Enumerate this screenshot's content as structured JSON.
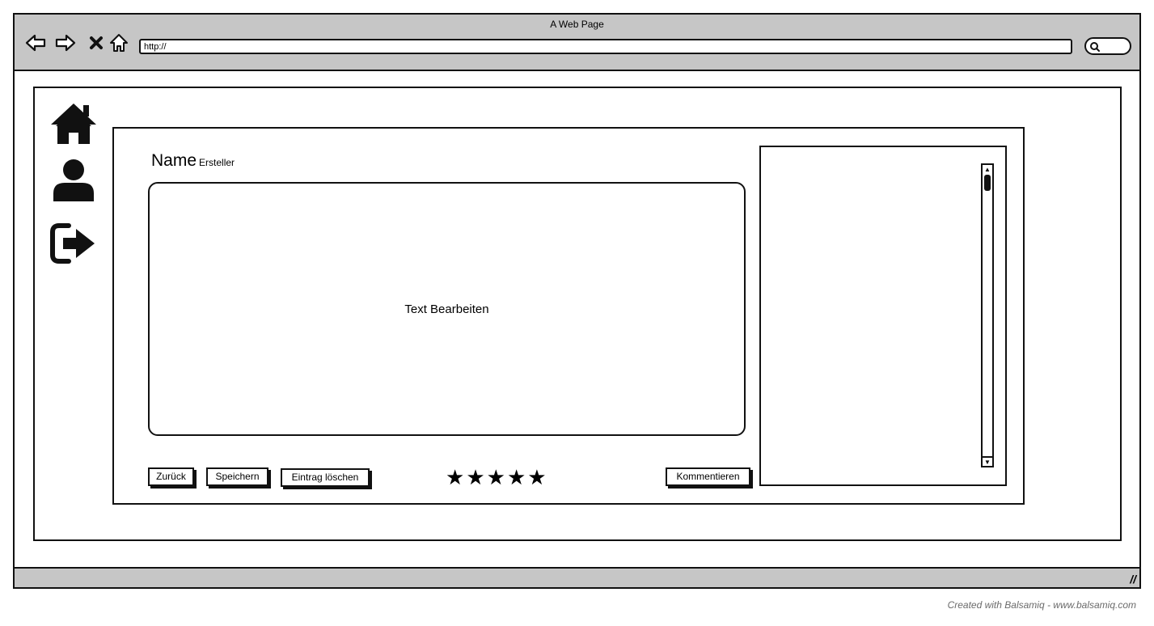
{
  "browser": {
    "title": "A Web Page",
    "url": "http://",
    "nav": {
      "back": "back-arrow-icon",
      "forward": "forward-arrow-icon",
      "stop": "close-icon",
      "home": "home-icon"
    }
  },
  "sidebar": {
    "items": [
      {
        "icon": "home-icon"
      },
      {
        "icon": "user-icon"
      },
      {
        "icon": "logout-icon"
      }
    ]
  },
  "entry": {
    "name": "Name",
    "creator": "Ersteller",
    "editor_text": "Text Bearbeiten"
  },
  "actions": {
    "back": "Zurück",
    "save": "Speichern",
    "delete": "Eintrag löschen",
    "comment": "Kommentieren"
  },
  "rating": {
    "stars": 5,
    "max": 5
  },
  "footer": "Created with Balsamiq - www.balsamiq.com",
  "colors": {
    "chrome": "#c6c6c6",
    "ink": "#111111",
    "footer_text": "#6b6b6b"
  }
}
